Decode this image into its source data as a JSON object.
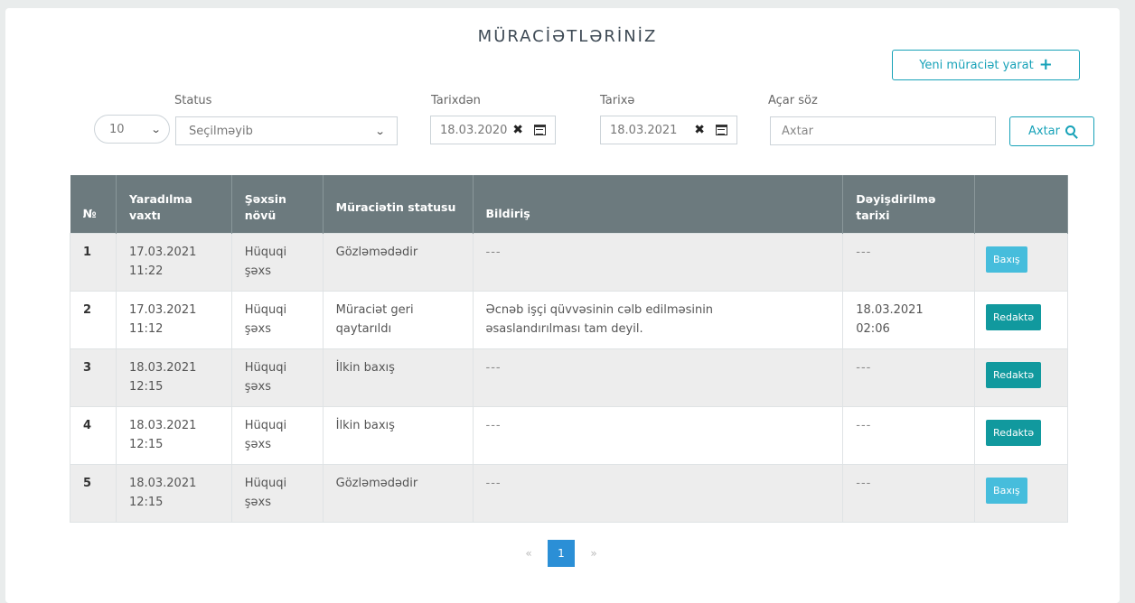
{
  "page": {
    "title": "MÜRACİƏTLƏRİNİZ",
    "new_button": "Yeni müraciət yarat"
  },
  "filters": {
    "per_page": "10",
    "status_label": "Status",
    "status_value": "Seçilməyib",
    "from_label": "Tarixdən",
    "from_value": "18.03.2020",
    "to_label": "Tarixə",
    "to_value": "18.03.2021",
    "keyword_label": "Açar söz",
    "keyword_placeholder": "Axtar",
    "search_button": "Axtar"
  },
  "table": {
    "headers": [
      "№",
      "Yaradılma vaxtı",
      "Şəxsin növü",
      "Müraciətin statusu",
      "Bildiriş",
      "Dəyişdirilmə tarixi",
      ""
    ],
    "rows": [
      {
        "no": "1",
        "created": "17.03.2021",
        "created_time": "11:22",
        "person": "Hüquqi şəxs",
        "status": "Gözləmədədir",
        "note": "---",
        "modified": "---",
        "modified_time": "",
        "action": "Baxış",
        "action_type": "view"
      },
      {
        "no": "2",
        "created": "17.03.2021",
        "created_time": "11:12",
        "person": "Hüquqi şəxs",
        "status": "Müraciət geri qaytarıldı",
        "note": "Əcnəb işçi qüvvəsinin cəlb edilməsinin əsaslandırılması tam deyil.",
        "modified": "18.03.2021",
        "modified_time": "02:06",
        "action": "Redaktə",
        "action_type": "edit"
      },
      {
        "no": "3",
        "created": "18.03.2021",
        "created_time": "12:15",
        "person": "Hüquqi şəxs",
        "status": "İlkin baxış",
        "note": "---",
        "modified": "---",
        "modified_time": "",
        "action": "Redaktə",
        "action_type": "edit"
      },
      {
        "no": "4",
        "created": "18.03.2021",
        "created_time": "12:15",
        "person": "Hüquqi şəxs",
        "status": "İlkin baxış",
        "note": "---",
        "modified": "---",
        "modified_time": "",
        "action": "Redaktə",
        "action_type": "edit"
      },
      {
        "no": "5",
        "created": "18.03.2021",
        "created_time": "12:15",
        "person": "Hüquqi şəxs",
        "status": "Gözləmədədir",
        "note": "---",
        "modified": "---",
        "modified_time": "",
        "action": "Baxış",
        "action_type": "view"
      }
    ]
  },
  "pagination": {
    "prev": "«",
    "current": "1",
    "next": "»"
  },
  "colors": {
    "accent": "#17a2b8",
    "header_bg": "#6c7a7e",
    "view_btn": "#46bddc",
    "edit_btn": "#11999e",
    "page_active": "#2b8fd6"
  }
}
